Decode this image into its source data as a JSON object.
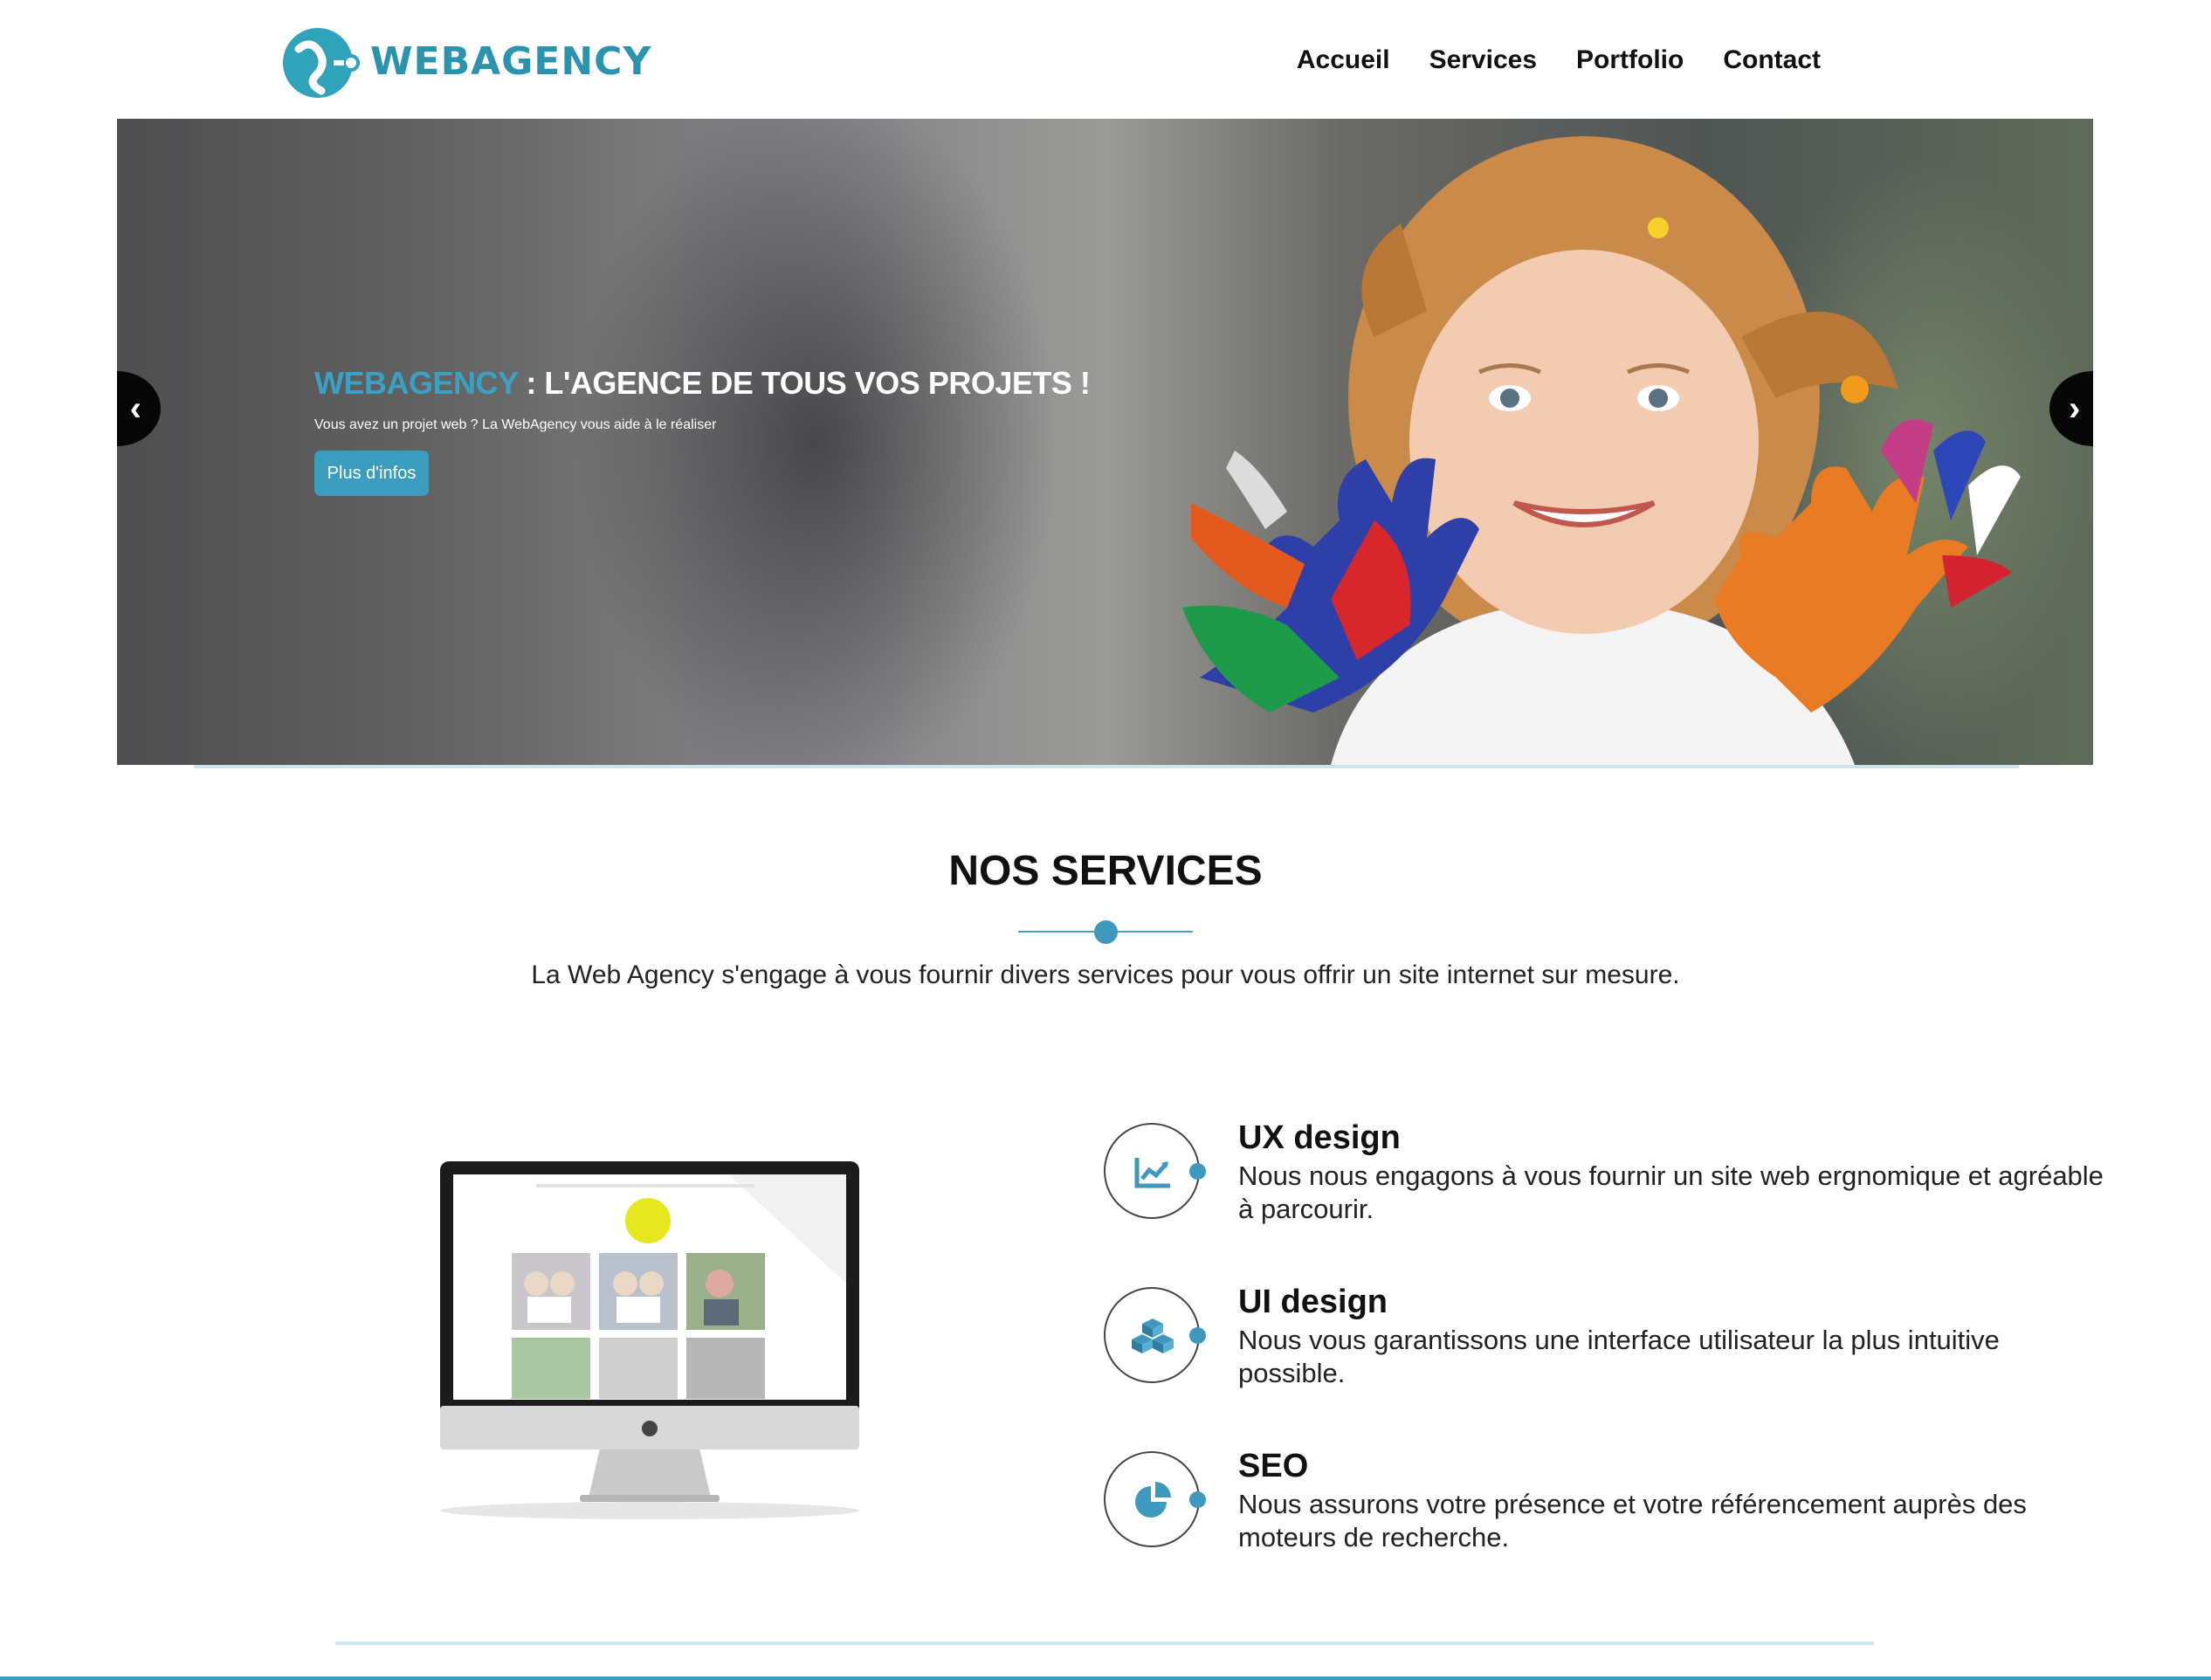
{
  "header": {
    "logo_text": "WEBAGENCY",
    "nav": [
      {
        "label": "Accueil"
      },
      {
        "label": "Services"
      },
      {
        "label": "Portfolio"
      },
      {
        "label": "Contact"
      }
    ]
  },
  "hero": {
    "title_brand": "WEBAGENCY",
    "title_rest": " : L'AGENCE DE TOUS VOS PROJETS !",
    "subtitle": "Vous avez un projet web ? La WebAgency vous aide à le réaliser",
    "button_label": "Plus d'infos",
    "prev_arrow": "‹",
    "next_arrow": "›"
  },
  "services": {
    "title": "NOS SERVICES",
    "intro": "La Web Agency s'engage à vous fournir divers services pour vous offrir un site internet sur mesure.",
    "items": [
      {
        "title": "UX design",
        "description": "Nous nous engagons à vous fournir un site web ergnomique et agréable à parcourir.",
        "icon": "chart-line-icon"
      },
      {
        "title": "UI design",
        "description": "Nous vous garantissons une interface utilisateur la plus intuitive possible.",
        "icon": "cubes-icon"
      },
      {
        "title": "SEO",
        "description": "Nous assurons votre présence et votre référencement auprès des moteurs de recherche.",
        "icon": "pie-chart-icon"
      }
    ]
  },
  "colors": {
    "brand": "#2c93ae",
    "accent": "#3c9cbd",
    "divider": "#cfe3ec"
  }
}
